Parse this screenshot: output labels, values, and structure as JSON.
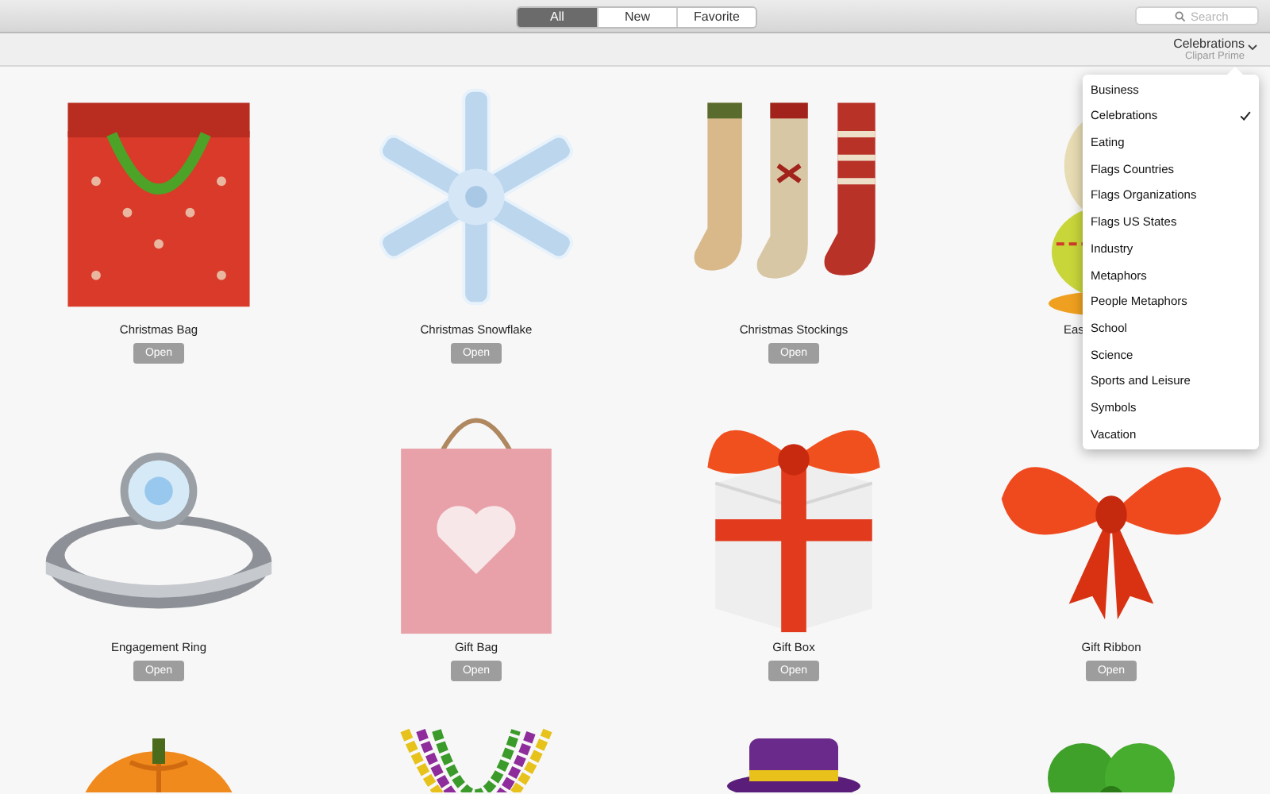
{
  "tabs": [
    {
      "label": "All",
      "selected": true
    },
    {
      "label": "New",
      "selected": false
    },
    {
      "label": "Favorite",
      "selected": false
    }
  ],
  "search": {
    "placeholder": "Search"
  },
  "category": {
    "title": "Celebrations",
    "subtitle": "Clipart Prime"
  },
  "menu": [
    {
      "label": "Business",
      "selected": false
    },
    {
      "label": "Celebrations",
      "selected": true
    },
    {
      "label": "Eating",
      "selected": false
    },
    {
      "label": "Flags Countries",
      "selected": false
    },
    {
      "label": "Flags Organizations",
      "selected": false
    },
    {
      "label": "Flags US States",
      "selected": false
    },
    {
      "label": "Industry",
      "selected": false
    },
    {
      "label": "Metaphors",
      "selected": false
    },
    {
      "label": "People Metaphors",
      "selected": false
    },
    {
      "label": "School",
      "selected": false
    },
    {
      "label": "Science",
      "selected": false
    },
    {
      "label": "Sports and Leisure",
      "selected": false
    },
    {
      "label": "Symbols",
      "selected": false
    },
    {
      "label": "Vacation",
      "selected": false
    }
  ],
  "items": [
    {
      "title": "Christmas Bag",
      "button": "Open"
    },
    {
      "title": "Christmas Snowflake",
      "button": "Open"
    },
    {
      "title": "Christmas Stockings",
      "button": "Open"
    },
    {
      "title": "Eas",
      "kind": "partial"
    },
    {
      "title": "Engagement Ring",
      "button": "Open"
    },
    {
      "title": "Gift Bag",
      "button": "Open"
    },
    {
      "title": "Gift Box",
      "button": "Open"
    },
    {
      "title": "Gift Ribbon",
      "button": "Open"
    },
    {
      "kind": "picture"
    },
    {
      "kind": "picture"
    },
    {
      "kind": "picture"
    },
    {
      "kind": "picture"
    }
  ]
}
